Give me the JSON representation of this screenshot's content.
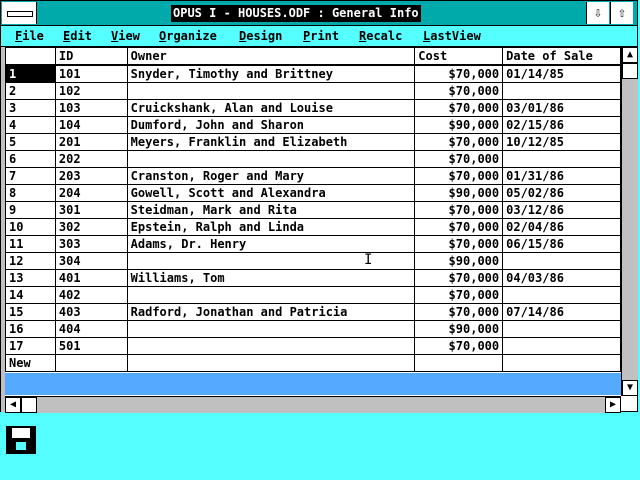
{
  "window": {
    "title": "OPUS I - HOUSES.ODF : General Info"
  },
  "title_buttons": {
    "minimize": "⇩",
    "maximize": "⇧"
  },
  "menu": [
    {
      "label": "File"
    },
    {
      "label": "Edit"
    },
    {
      "label": "View"
    },
    {
      "label": "Organize"
    },
    {
      "label": "Design"
    },
    {
      "label": "Print"
    },
    {
      "label": "Recalc"
    },
    {
      "label": "LastView"
    }
  ],
  "columns": {
    "id": "ID",
    "owner": "Owner",
    "cost": "Cost",
    "date": "Date of Sale"
  },
  "rows": [
    {
      "n": "1",
      "id": "101",
      "owner": "Snyder, Timothy and Brittney",
      "cost": "$70,000",
      "date": "01/14/85"
    },
    {
      "n": "2",
      "id": "102",
      "owner": "",
      "cost": "$70,000",
      "date": ""
    },
    {
      "n": "3",
      "id": "103",
      "owner": "Cruickshank, Alan and Louise",
      "cost": "$70,000",
      "date": "03/01/86"
    },
    {
      "n": "4",
      "id": "104",
      "owner": "Dumford, John and Sharon",
      "cost": "$90,000",
      "date": "02/15/86"
    },
    {
      "n": "5",
      "id": "201",
      "owner": "Meyers, Franklin and Elizabeth",
      "cost": "$70,000",
      "date": "10/12/85"
    },
    {
      "n": "6",
      "id": "202",
      "owner": "",
      "cost": "$70,000",
      "date": ""
    },
    {
      "n": "7",
      "id": "203",
      "owner": "Cranston, Roger and Mary",
      "cost": "$70,000",
      "date": "01/31/86"
    },
    {
      "n": "8",
      "id": "204",
      "owner": "Gowell, Scott and Alexandra",
      "cost": "$90,000",
      "date": "05/02/86"
    },
    {
      "n": "9",
      "id": "301",
      "owner": "Steidman, Mark and Rita",
      "cost": "$70,000",
      "date": "03/12/86"
    },
    {
      "n": "10",
      "id": "302",
      "owner": "Epstein, Ralph and Linda",
      "cost": "$70,000",
      "date": "02/04/86"
    },
    {
      "n": "11",
      "id": "303",
      "owner": "Adams, Dr. Henry",
      "cost": "$70,000",
      "date": "06/15/86"
    },
    {
      "n": "12",
      "id": "304",
      "owner": "",
      "cost": "$90,000",
      "date": ""
    },
    {
      "n": "13",
      "id": "401",
      "owner": "Williams, Tom",
      "cost": "$70,000",
      "date": "04/03/86"
    },
    {
      "n": "14",
      "id": "402",
      "owner": "",
      "cost": "$70,000",
      "date": ""
    },
    {
      "n": "15",
      "id": "403",
      "owner": "Radford, Jonathan and Patricia",
      "cost": "$70,000",
      "date": "07/14/86"
    },
    {
      "n": "16",
      "id": "404",
      "owner": "",
      "cost": "$90,000",
      "date": ""
    },
    {
      "n": "17",
      "id": "501",
      "owner": "",
      "cost": "$70,000",
      "date": ""
    }
  ],
  "new_row_label": "New",
  "selected_row": "1",
  "colors": {
    "desktop": "#55ffff",
    "titlebar": "#00aaaa",
    "empty_area": "#55aaff"
  },
  "icons": {
    "desktop_icon": "floppy-disk-icon"
  }
}
